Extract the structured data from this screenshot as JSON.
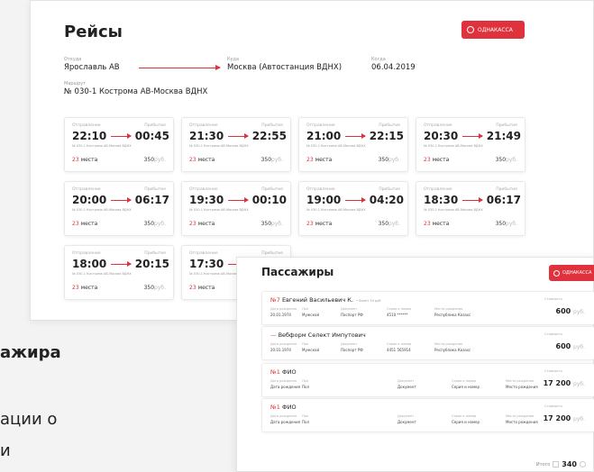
{
  "flights": {
    "title": "Рейсы",
    "brand_button": "ОДНАКАССА",
    "from_label": "Откуда",
    "from_value": "Ярославль АВ",
    "to_label": "Куда",
    "to_value": "Москва (Автостанция ВДНХ)",
    "date_label": "Когда",
    "date_value": "06.04.2019",
    "route_label": "Маршрут",
    "route_value": "№ 030-1 Кострома АВ-Москва ВДНХ",
    "cards": [
      {
        "dep_label": "Отправление",
        "arr_label": "Прибытие",
        "dep": "22:10",
        "arr": "00:45",
        "route": "№ 030-1 Кострома АВ-Москва ВДНХ",
        "seats_n": "23",
        "seats_word": "места",
        "price": "350",
        "currency": "руб."
      },
      {
        "dep_label": "Отправление",
        "arr_label": "Прибытие",
        "dep": "21:30",
        "arr": "22:55",
        "route": "№ 030-1 Кострома АВ-Москва ВДНХ",
        "seats_n": "23",
        "seats_word": "места",
        "price": "350",
        "currency": "руб."
      },
      {
        "dep_label": "Отправление",
        "arr_label": "Прибытие",
        "dep": "21:00",
        "arr": "22:15",
        "route": "№ 030-1 Кострома АВ-Москва ВДНХ",
        "seats_n": "23",
        "seats_word": "места",
        "price": "350",
        "currency": "руб."
      },
      {
        "dep_label": "Отправление",
        "arr_label": "Прибытие",
        "dep": "20:30",
        "arr": "21:49",
        "route": "№ 030-1 Кострома АВ-Москва ВДНХ",
        "seats_n": "23",
        "seats_word": "места",
        "price": "350",
        "currency": "руб."
      },
      {
        "dep_label": "Отправление",
        "arr_label": "Прибытие",
        "dep": "20:00",
        "arr": "06:17",
        "route": "№ 030-1 Кострома АВ-Москва ВДНХ",
        "seats_n": "23",
        "seats_word": "места",
        "price": "350",
        "currency": "руб."
      },
      {
        "dep_label": "Отправление",
        "arr_label": "Прибытие",
        "dep": "19:30",
        "arr": "00:10",
        "route": "№ 030-1 Кострома АВ-Москва ВДНХ",
        "seats_n": "23",
        "seats_word": "места",
        "price": "350",
        "currency": "руб."
      },
      {
        "dep_label": "Отправление",
        "arr_label": "Прибытие",
        "dep": "19:00",
        "arr": "04:20",
        "route": "№ 030-1 Кострома АВ-Москва ВДНХ",
        "seats_n": "23",
        "seats_word": "места",
        "price": "350",
        "currency": "руб."
      },
      {
        "dep_label": "Отправление",
        "arr_label": "Прибытие",
        "dep": "18:30",
        "arr": "06:17",
        "route": "№ 030-1 Кострома АВ-Москва ВДНХ",
        "seats_n": "23",
        "seats_word": "места",
        "price": "350",
        "currency": "руб."
      },
      {
        "dep_label": "Отправление",
        "arr_label": "Прибытие",
        "dep": "18:00",
        "arr": "20:15",
        "route": "№ 030-1 Кострома АВ-Москва ВДНХ",
        "seats_n": "23",
        "seats_word": "места",
        "price": "350",
        "currency": "руб."
      },
      {
        "dep_label": "Отправление",
        "arr_label": "Прибытие",
        "dep": "17:30",
        "arr": "",
        "route": "№ 030-1 Кострома АВ-Москва ВДНХ",
        "seats_n": "23",
        "seats_word": "места",
        "price": "",
        "currency": ""
      }
    ]
  },
  "background_text": {
    "line1": "ажира",
    "line2": "ации о",
    "line3": "и"
  },
  "passengers": {
    "title": "Пассажиры",
    "brand_button": "ОДНАКАССА",
    "rows": [
      {
        "num": "№7",
        "name": "Евгений Васильевич К.",
        "tag": "• Билет 34 руб",
        "labels": [
          "Дата рождения",
          "Пол",
          "Документ",
          "Серия и номер",
          "Место рождения"
        ],
        "values": [
          "20.01.1974",
          "Мужской",
          "Паспорт РФ",
          "4510 ******",
          "Республика Казахс"
        ],
        "cost_label": "Стоимость",
        "cost": "600",
        "currency": "руб."
      },
      {
        "num": "—",
        "name": "Вебформ Селект Импутович",
        "tag": "",
        "labels": [
          "Дата рождения",
          "Пол",
          "Документ",
          "Серия и номер",
          "Место рождения"
        ],
        "values": [
          "20.01.1974",
          "Мужской",
          "Паспорт РФ",
          "4451 565914",
          "Республика Казахс"
        ],
        "cost_label": "Стоимость",
        "cost": "600",
        "currency": "руб."
      },
      {
        "num": "№1",
        "name": "ФИО",
        "tag": "",
        "labels": [
          "Дата рождения",
          "Пол",
          "Документ",
          "Серия и номер",
          "Место рождения"
        ],
        "values": [
          "Дата рождения",
          "Пол",
          "Документ",
          "Серия и номер",
          "Место рождения"
        ],
        "cost_label": "Стоимость",
        "cost": "17 200",
        "currency": "руб."
      },
      {
        "num": "№1",
        "name": "ФИО",
        "tag": "",
        "labels": [
          "Дата рождения",
          "Пол",
          "Документ",
          "Серия и номер",
          "Место рождения"
        ],
        "values": [
          "Дата рождения",
          "Пол",
          "Документ",
          "Серия и номер",
          "Место рождения"
        ],
        "cost_label": "Стоимость",
        "cost": "17 200",
        "currency": "руб."
      }
    ],
    "total_label": "Итого",
    "total_value": "340"
  },
  "colors": {
    "accent": "#e0323c"
  }
}
